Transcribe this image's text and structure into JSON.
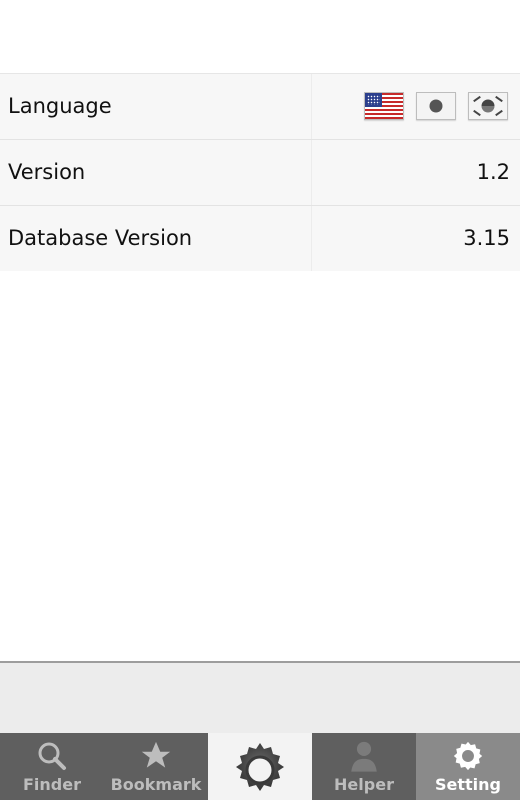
{
  "settings": {
    "rows": [
      {
        "label": "Language"
      },
      {
        "label": "Version",
        "value": "1.2"
      },
      {
        "label": "Database Version",
        "value": "3.15"
      }
    ],
    "languages": [
      {
        "icon": "us-flag-icon"
      },
      {
        "icon": "japan-flag-icon"
      },
      {
        "icon": "korea-flag-icon"
      }
    ]
  },
  "tabbar": {
    "tabs": [
      {
        "label": "Finder",
        "icon": "search-icon"
      },
      {
        "label": "Bookmark",
        "icon": "star-icon"
      },
      {
        "label": "",
        "icon": "gear-emblem-icon"
      },
      {
        "label": "Helper",
        "icon": "person-icon"
      },
      {
        "label": "Setting",
        "icon": "gear-icon"
      }
    ],
    "active": "Setting"
  },
  "colors": {
    "row_bg": "#f7f7f7",
    "tabbar_bg": "#5f5f5f",
    "active_tab_bg": "#8a8a8a"
  }
}
